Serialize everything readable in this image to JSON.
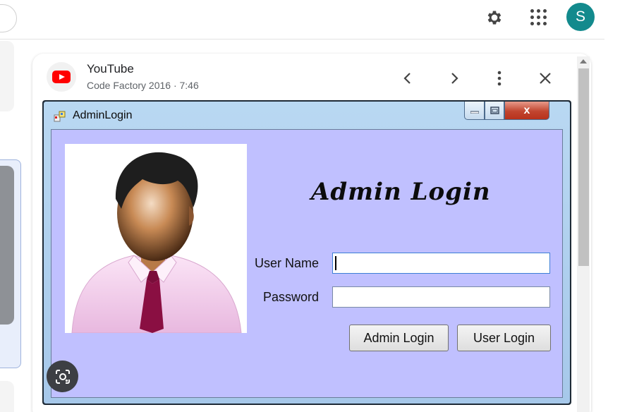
{
  "topbar": {
    "settings_icon": "gear-icon",
    "apps_icon": "apps-grid-icon",
    "avatar_letter": "S",
    "avatar_color": "#138a8d"
  },
  "viewer": {
    "source_title": "YouTube",
    "source_subtitle": "Code Factory 2016 · 7:46",
    "source_icon": "youtube-icon",
    "prev_icon": "chevron-left-icon",
    "next_icon": "chevron-right-icon",
    "more_icon": "more-vert-icon",
    "close_icon": "close-icon"
  },
  "window": {
    "title": "AdminLogin",
    "close_glyph": "x",
    "client_color": "#c0c0ff",
    "heading": "Admin Login",
    "username_label": "User Name",
    "username_value": "",
    "password_label": "Password",
    "password_value": "",
    "admin_login_button": "Admin Login",
    "user_login_button": "User Login"
  },
  "lens_icon": "google-lens-icon"
}
